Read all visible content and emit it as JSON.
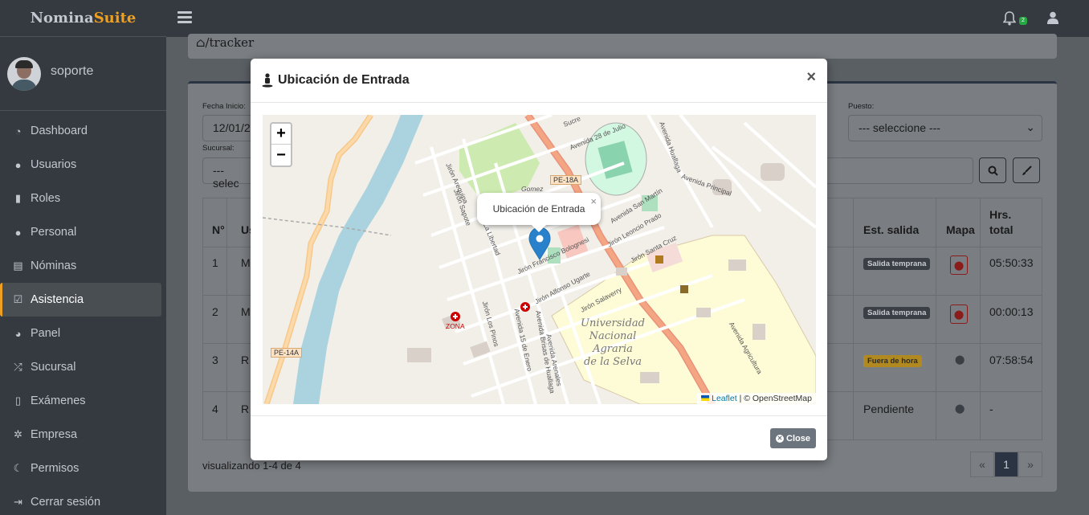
{
  "brand": {
    "part1": "Nomina",
    "part2": "Suite"
  },
  "user": {
    "name": "soporte"
  },
  "sidebar": {
    "items": [
      {
        "label": "Dashboard",
        "icon": "dashboard-icon"
      },
      {
        "label": "Usuarios",
        "icon": "user-icon"
      },
      {
        "label": "Roles",
        "icon": "unlock-icon"
      },
      {
        "label": "Personal",
        "icon": "users-icon"
      },
      {
        "label": "Nóminas",
        "icon": "id-card-icon"
      },
      {
        "label": "Asistencia",
        "icon": "check-square-icon",
        "active": true
      },
      {
        "label": "Panel",
        "icon": "gauge-icon"
      },
      {
        "label": "Sucursal",
        "icon": "random-icon"
      },
      {
        "label": "Exámenes",
        "icon": "file-icon"
      },
      {
        "label": "Empresa",
        "icon": "gear-icon"
      },
      {
        "label": "Permisos",
        "icon": "moon-icon"
      },
      {
        "label": "Cerrar sesión",
        "icon": "sign-out-icon"
      }
    ]
  },
  "topbar": {
    "notification_count": "2"
  },
  "breadcrumb": {
    "text": "/tracker"
  },
  "filters": {
    "fecha_inicio_label": "Fecha Inicio:",
    "fecha_inicio_value": "12/01/2",
    "puesto_label": "Puesto:",
    "puesto_value": "--- seleccione ---",
    "sucursal_label": "Sucursal:",
    "sucursal_value": "--- selec"
  },
  "table": {
    "headers": {
      "n": "N°",
      "us": "Us",
      "est_salida": "Est. salida",
      "mapa": "Mapa",
      "hrs_total_1": "Hrs.",
      "hrs_total_2": "total"
    },
    "rows": [
      {
        "n": "1",
        "us": "M",
        "est_salida": "Salida temprana",
        "hrs": "05:50:33"
      },
      {
        "n": "2",
        "us": "M",
        "est_salida": "Salida temprana",
        "hrs": "00:00:13"
      },
      {
        "n": "3",
        "us": "R",
        "est_salida": "Fuera de hora",
        "hrs": "07:58:54"
      },
      {
        "n": "4",
        "us": "R",
        "est_salida": "Pendiente",
        "hrs": "-"
      }
    ]
  },
  "footer": {
    "showing": "visualizando 1-4 de 4"
  },
  "pagination": {
    "prev": "«",
    "current": "1",
    "next": "»"
  },
  "modal": {
    "title": "Ubicación de Entrada",
    "close_x": "×",
    "popup_text": "Ubicación de Entrada",
    "popup_close": "×",
    "zoom_in": "+",
    "zoom_out": "−",
    "attribution_link": "Leaflet",
    "attribution_text": "| © OpenStreetMap",
    "close_button": "Close",
    "map_labels": {
      "university": [
        "Universidad",
        "Nacional",
        "Agraria",
        "de la Selva"
      ],
      "road1": "PE-18A",
      "road2": "PE-14A",
      "zona": "ZONA",
      "gomez": "Gomez",
      "streets": [
        "Jirón Francisco Bolognesi",
        "Jirón Alfonso Ugarte",
        "Jirón Salaverry",
        "Jirón Santa Cruz",
        "Jirón Leoncio Prado",
        "Avenida San Martín",
        "Avenida Principal",
        "Jirón Sapote",
        "Jirón La Libertad",
        "Jirón Los Pinos",
        "Avenida 15 de Enero",
        "Avenida Brisas de Huallaga",
        "Avenida Agricultura",
        "Avenida Arenales",
        "Avenida Huallaga",
        "Avenida 28 de Julio",
        "Jirón Arequipa",
        "Sucre"
      ]
    }
  },
  "colors": {
    "accent": "#f0a020",
    "sidebar": "#343a40",
    "map_water": "#aad3df",
    "map_road": "#f4a582",
    "marker": "#2a81cb"
  }
}
